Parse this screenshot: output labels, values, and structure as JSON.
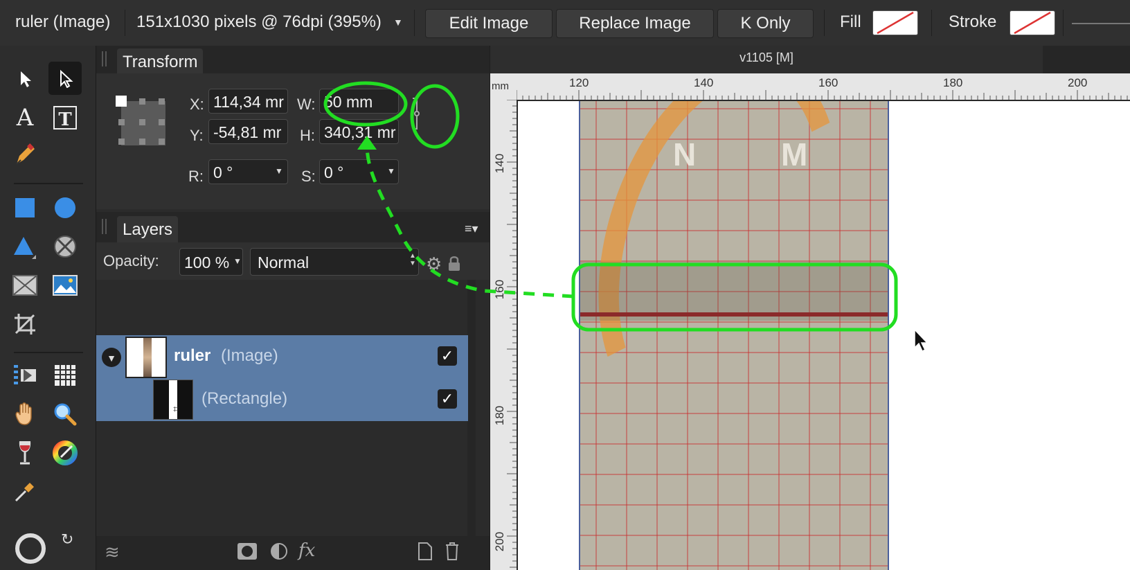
{
  "context_bar": {
    "object_type": "ruler (Image)",
    "image_info": "151x1030 pixels @ 76dpi (395%)",
    "buttons": [
      "Edit Image",
      "Replace Image",
      "K Only"
    ],
    "fill_label": "Fill",
    "stroke_label": "Stroke"
  },
  "document": {
    "tab_title": "v1105  [M]"
  },
  "transform": {
    "tab_label": "Transform",
    "x_label": "X:",
    "x_value": "114,34 mr",
    "y_label": "Y:",
    "y_value": "-54,81 mr",
    "w_label": "W:",
    "w_value": "50 mm",
    "h_label": "H:",
    "h_value": "340,31 mr",
    "r_label": "R:",
    "r_value": "0 °",
    "s_label": "S:",
    "s_value": "0 °"
  },
  "layers": {
    "tab_label": "Layers",
    "opacity_label": "Opacity:",
    "opacity_value": "100 %",
    "blend_mode": "Normal",
    "items": [
      {
        "name": "ruler",
        "type": "(Image)",
        "visible": true
      },
      {
        "name": "",
        "type": "(Rectangle)",
        "visible": true
      }
    ]
  },
  "ruler": {
    "unit": "mm",
    "h_ticks": [
      "120",
      "140",
      "160",
      "180",
      "200"
    ],
    "v_ticks": [
      "140",
      "160",
      "180",
      "200"
    ]
  },
  "image_content": {
    "letters": [
      "N",
      "M"
    ]
  },
  "colors": {
    "accent": "#5a7ea8",
    "annotation": "#22dd22",
    "selection_bg": "#5b7ca6"
  },
  "icons": [
    "move-tool-icon",
    "node-tool-icon",
    "artistic-text-icon",
    "frame-text-icon",
    "pen-tool-icon",
    "rectangle-tool-icon",
    "ellipse-tool-icon",
    "triangle-tool-icon",
    "donut-tool-icon",
    "picture-frame-icon",
    "image-placeholder-icon",
    "crop-tool-icon",
    "table-text-icon",
    "table-tool-icon",
    "hand-tool-icon",
    "zoom-tool-icon",
    "wine-glass-icon",
    "color-picker-icon",
    "eyedropper-icon",
    "link-constrain-icon",
    "gear-icon",
    "lock-icon",
    "panel-menu-icon",
    "layers-icon",
    "mask-icon",
    "adjustment-icon",
    "fx-icon",
    "new-doc-icon",
    "trash-icon",
    "cursor-icon"
  ]
}
